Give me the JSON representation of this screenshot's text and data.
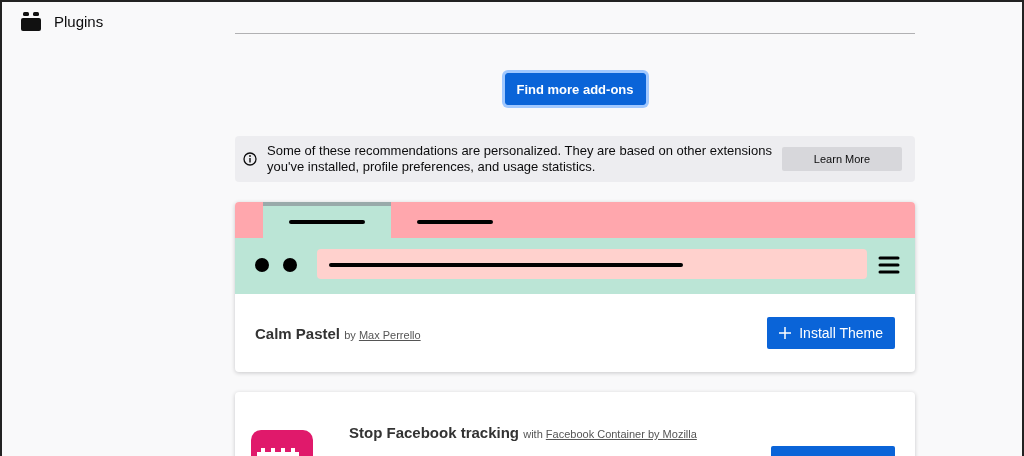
{
  "sidebar": {
    "items": [
      {
        "label": "Plugins"
      }
    ]
  },
  "find_more_button": "Find more add-ons",
  "notice": {
    "text": "Some of these recommendations are personalized. They are based on other extensions you've installed, profile preferences, and usage statistics.",
    "button": "Learn More"
  },
  "cards": [
    {
      "kind": "theme",
      "name": "Calm Pastel",
      "by": "by",
      "author": "Max Perrello",
      "button": "Install Theme"
    },
    {
      "kind": "extension",
      "name": "Stop Facebook tracking",
      "by": "with",
      "author": "Facebook Container by Mozilla"
    }
  ]
}
